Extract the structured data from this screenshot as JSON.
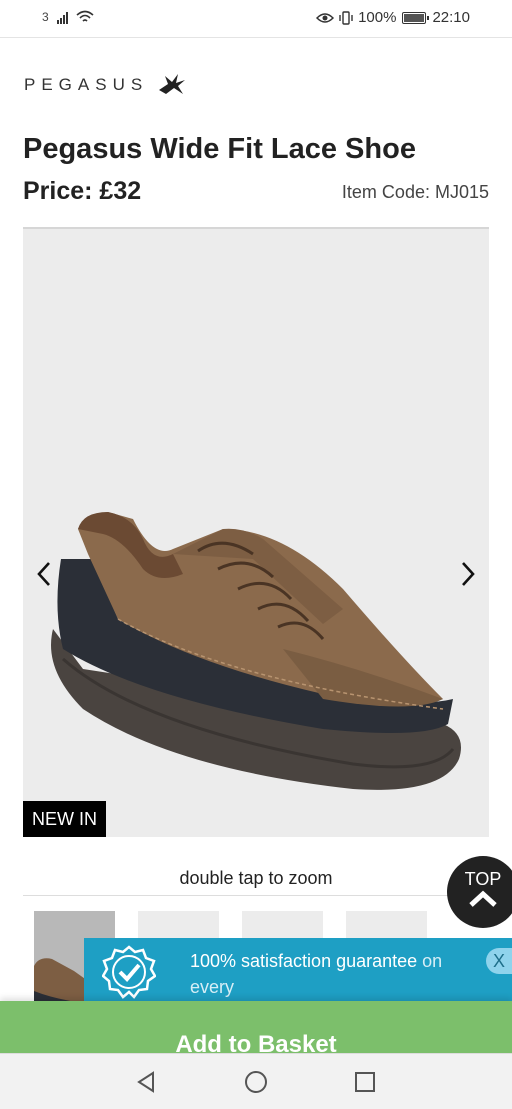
{
  "status_bar": {
    "carrier": "3",
    "battery": "100%",
    "time": "22:10"
  },
  "brand": {
    "name": "PEGASUS"
  },
  "product": {
    "title": "Pegasus Wide Fit Lace Shoe",
    "price": "Price: £32",
    "item_code": "Item Code: MJ015",
    "badge": "NEW IN",
    "zoom_hint": "double tap to zoom"
  },
  "gallery": {
    "thumbnail_count": 4
  },
  "top_button": {
    "label": "TOP"
  },
  "guarantee": {
    "text": "100% satisfaction guarantee",
    "text_suffix": "on",
    "text_line2": "every",
    "close": "X"
  },
  "basket": {
    "label": "Add to Basket"
  },
  "colors": {
    "guarantee_bg": "#1e9fc4",
    "basket_bg": "#7cbf6b",
    "image_bg": "#ececec"
  }
}
